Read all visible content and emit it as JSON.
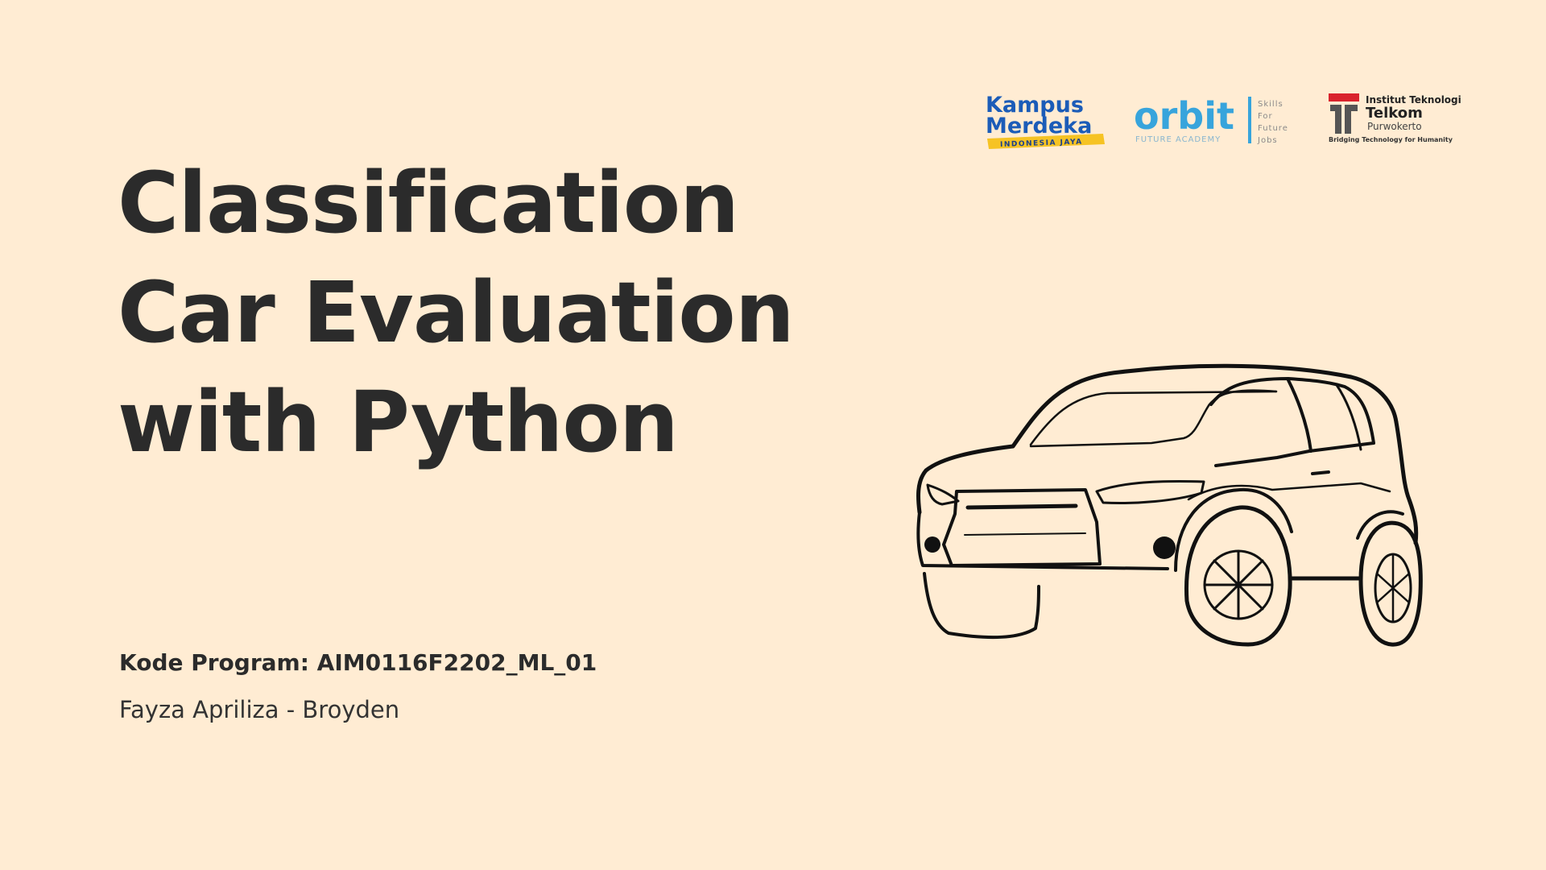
{
  "slide": {
    "title_lines": [
      "Classification",
      "Car Evaluation",
      "with Python"
    ],
    "kode_program": "Kode Program: AIM0116F2202_ML_01",
    "author": "Fayza Apriliza - Broyden"
  },
  "logos": {
    "kampus_merdeka": {
      "line1": "Kampus",
      "line2": "Merdeka",
      "tagline": "INDONESIA JAYA"
    },
    "orbit": {
      "wordmark": "orbit",
      "sub": "FUTURE ACADEMY",
      "tag1": "Skills",
      "tag2": "For",
      "tag3": "Future",
      "tag4": "Jobs"
    },
    "telkom": {
      "line1": "Institut Teknologi",
      "line2": "Telkom",
      "line3": "Purwokerto",
      "tagline": "Bridging Technology for Humanity"
    }
  },
  "colors": {
    "background": "#ffecd3",
    "text": "#2b2b2b",
    "kampus_blue": "#1b5cb8",
    "kampus_yellow": "#f6c324",
    "orbit_blue": "#37a4dc",
    "telkom_red": "#d9232d"
  },
  "illustration": "car-line-drawing"
}
